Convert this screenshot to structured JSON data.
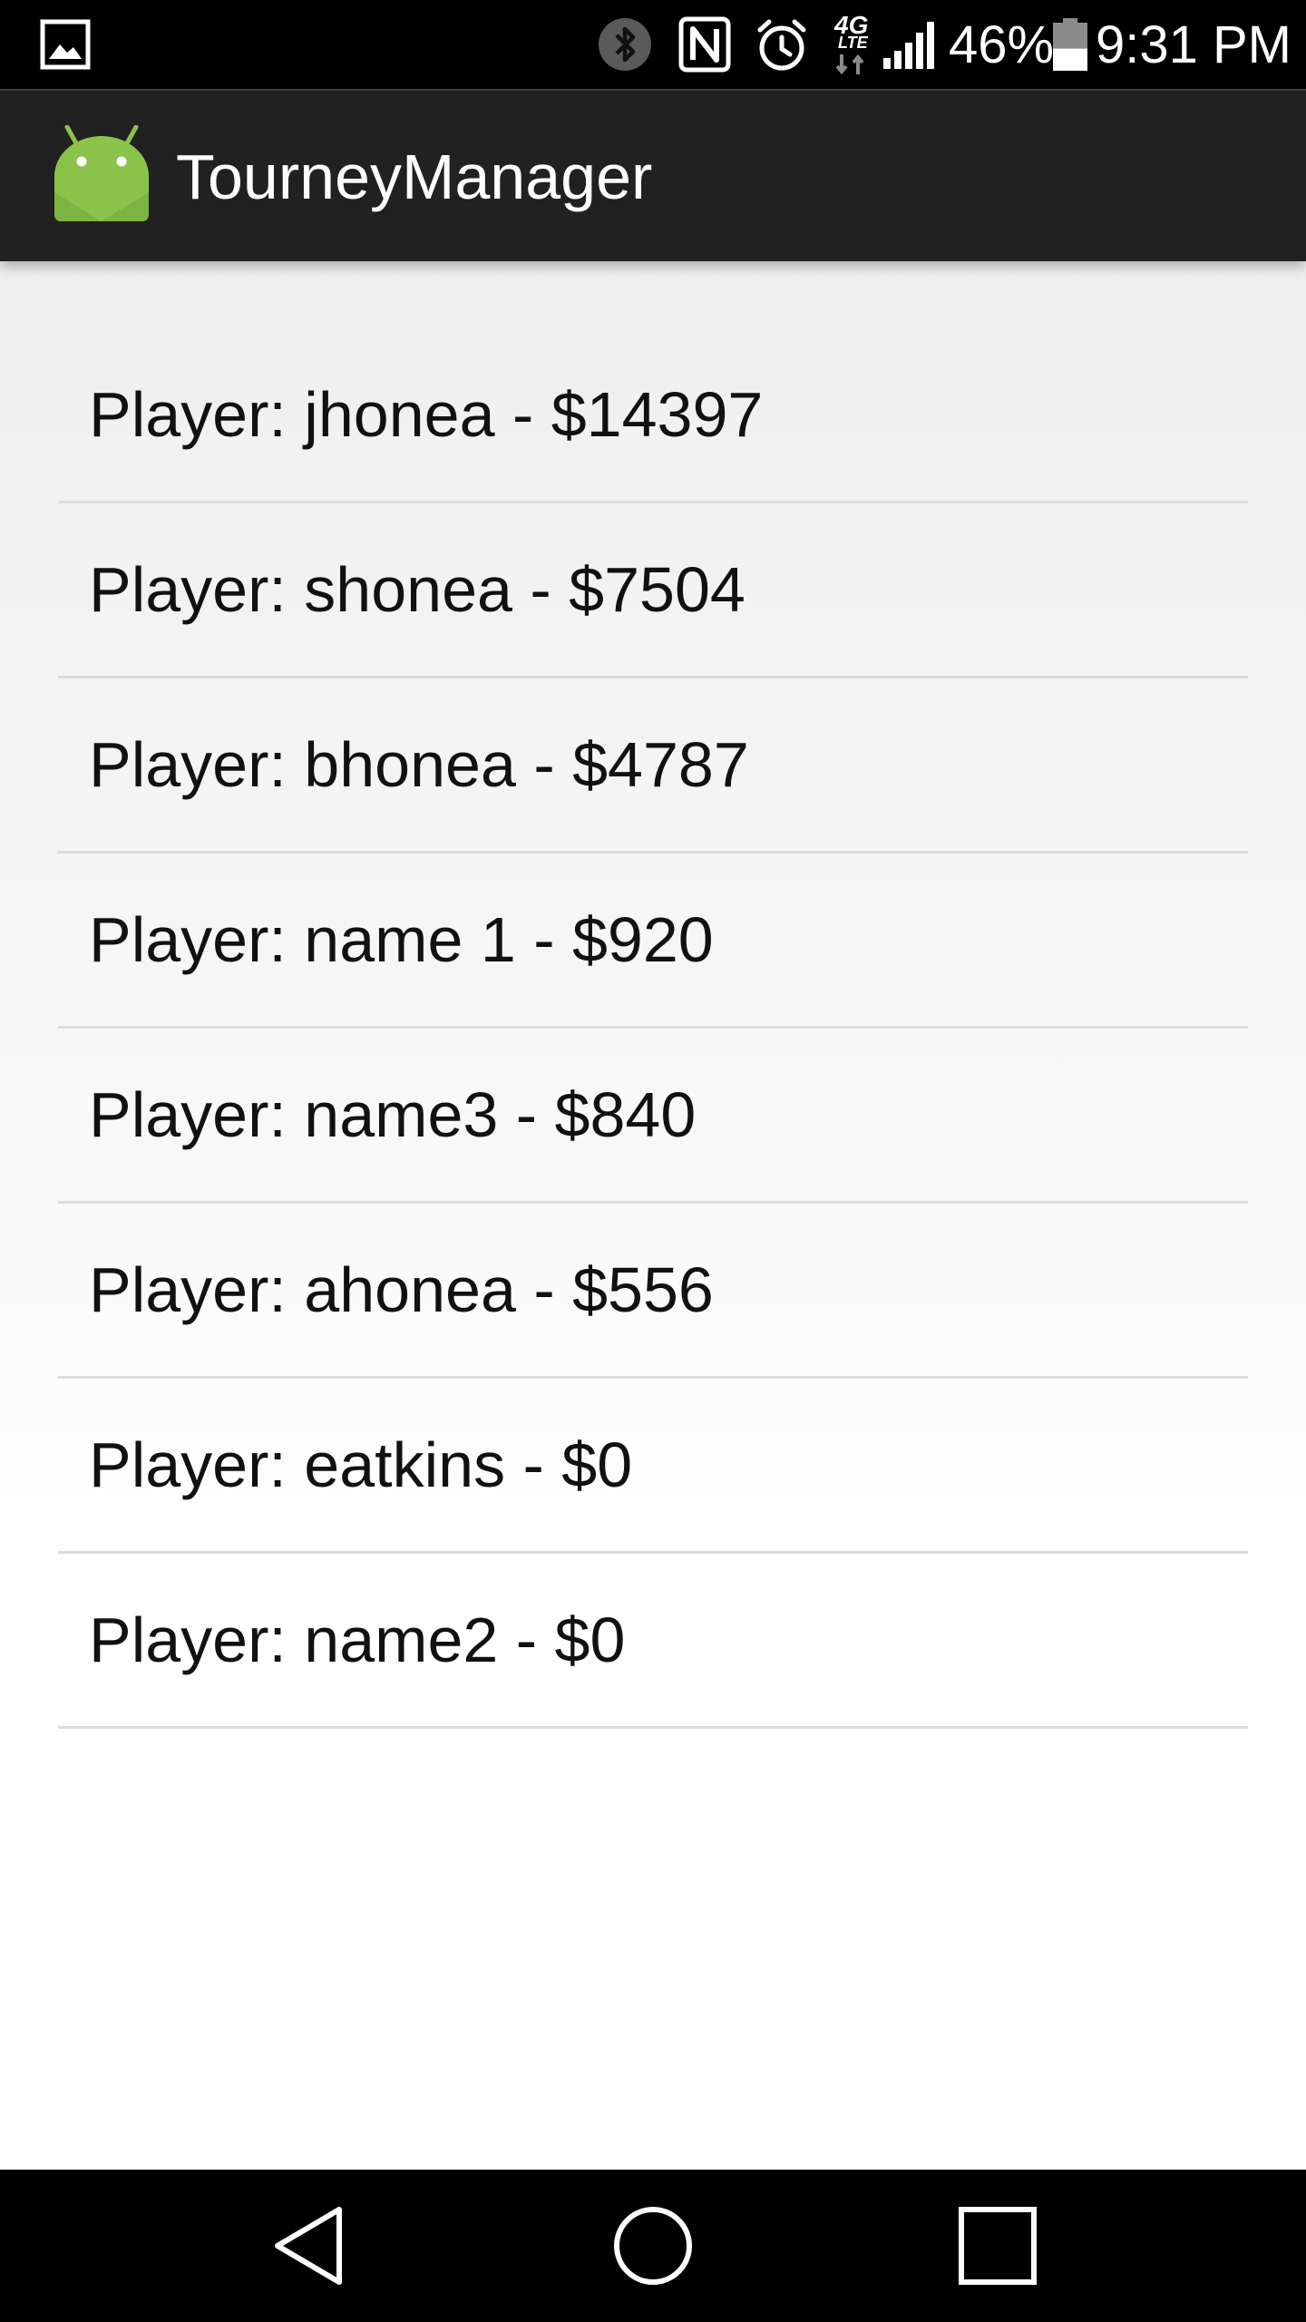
{
  "status_bar": {
    "battery_percent": "46%",
    "battery_level": 0.46,
    "time": "9:31 PM",
    "network_label": "4G",
    "network_sub": "LTE",
    "icons": [
      "gallery-notification-icon",
      "bluetooth-icon",
      "nfc-icon",
      "alarm-icon",
      "network-4g-lte-icon",
      "signal-icon",
      "battery-icon"
    ]
  },
  "action_bar": {
    "title": "TourneyManager",
    "icon": "android-robot-icon",
    "icon_color": "#8bc34a"
  },
  "players": [
    {
      "label": "Player: jhonea - $14397"
    },
    {
      "label": "Player: shonea - $7504"
    },
    {
      "label": "Player: bhonea - $4787"
    },
    {
      "label": "Player: name 1 - $920"
    },
    {
      "label": "Player: name3 - $840"
    },
    {
      "label": "Player: ahonea - $556"
    },
    {
      "label": "Player: eatkins - $0"
    },
    {
      "label": "Player: name2 - $0"
    }
  ],
  "nav_bar": {
    "buttons": [
      "back-icon",
      "home-icon",
      "recents-icon"
    ]
  }
}
